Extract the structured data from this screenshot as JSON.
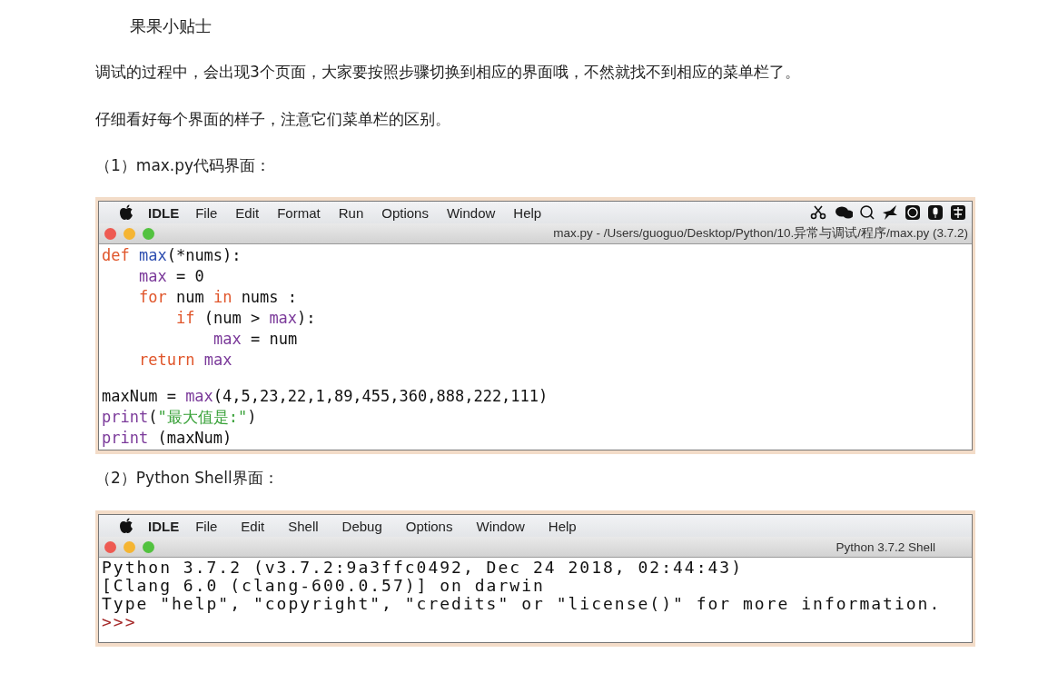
{
  "tip_title": "果果小贴士",
  "paragraphs": [
    "调试的过程中，会出现3个页面，大家要按照步骤切换到相应的界面哦，不然就找不到相应的菜单栏了。",
    "仔细看好每个界面的样子，注意它们菜单栏的区别。"
  ],
  "sections": [
    {
      "heading": "（1）max.py代码界面：",
      "window": {
        "kind": "editor",
        "app_name": "IDLE",
        "menus": [
          "File",
          "Edit",
          "Format",
          "Run",
          "Options",
          "Window",
          "Help"
        ],
        "status_icons": true,
        "title": "max.py - /Users/guoguo/Desktop/Python/10.异常与调试/程序/max.py (3.7.2)",
        "lines": [
          {
            "kind": "code",
            "segments": [
              {
                "kind": "keyword",
                "text": "def"
              },
              {
                "kind": "defname",
                "text": " max"
              },
              {
                "kind": "plain",
                "text": "(*nums):"
              }
            ],
            "children": [
              {
                "kind": "code",
                "segments": [
                  {
                    "kind": "builtin",
                    "text": "max"
                  },
                  {
                    "kind": "plain",
                    "text": " = 0"
                  }
                ]
              },
              {
                "kind": "code",
                "segments": [
                  {
                    "kind": "keyword",
                    "text": "for"
                  },
                  {
                    "kind": "plain",
                    "text": " num "
                  },
                  {
                    "kind": "keyword",
                    "text": "in"
                  },
                  {
                    "kind": "plain",
                    "text": " nums :"
                  }
                ],
                "children": [
                  {
                    "kind": "code",
                    "segments": [
                      {
                        "kind": "keyword",
                        "text": "if"
                      },
                      {
                        "kind": "plain",
                        "text": " (num > "
                      },
                      {
                        "kind": "builtin",
                        "text": "max"
                      },
                      {
                        "kind": "plain",
                        "text": "):"
                      }
                    ],
                    "children": [
                      {
                        "kind": "code",
                        "segments": [
                          {
                            "kind": "builtin",
                            "text": "max"
                          },
                          {
                            "kind": "plain",
                            "text": " = num"
                          }
                        ]
                      }
                    ]
                  }
                ]
              },
              {
                "kind": "code",
                "segments": [
                  {
                    "kind": "keyword",
                    "text": "return"
                  },
                  {
                    "kind": "builtin",
                    "text": " max"
                  }
                ]
              }
            ]
          },
          {
            "kind": "blank"
          },
          {
            "kind": "code",
            "segments": [
              {
                "kind": "plain",
                "text": "maxNum = "
              },
              {
                "kind": "builtin",
                "text": "max"
              },
              {
                "kind": "plain",
                "text": "(4,5,23,22,1,89,455,360,888,222,111)"
              }
            ]
          },
          {
            "kind": "code",
            "segments": [
              {
                "kind": "builtin",
                "text": "print"
              },
              {
                "kind": "plain",
                "text": "("
              },
              {
                "kind": "string",
                "text": "\"最大值是:\""
              },
              {
                "kind": "plain",
                "text": ")"
              }
            ]
          },
          {
            "kind": "code",
            "segments": [
              {
                "kind": "builtin",
                "text": "print"
              },
              {
                "kind": "plain",
                "text": " (maxNum)"
              }
            ]
          }
        ]
      }
    },
    {
      "heading": "（2）Python Shell界面：",
      "window": {
        "kind": "shell",
        "app_name": "IDLE",
        "menus": [
          "File",
          "Edit",
          "Shell",
          "Debug",
          "Options",
          "Window",
          "Help"
        ],
        "status_icons": false,
        "title": "Python 3.7.2 Shell",
        "lines": [
          {
            "kind": "code",
            "segments": [
              {
                "kind": "plain",
                "text": "Python 3.7.2 (v3.7.2:9a3ffc0492, Dec 24 2018, 02:44:43)"
              }
            ]
          },
          {
            "kind": "code",
            "segments": [
              {
                "kind": "plain",
                "text": "[Clang 6.0 (clang-600.0.57)] on darwin"
              }
            ]
          },
          {
            "kind": "code",
            "segments": [
              {
                "kind": "plain",
                "text": "Type \"help\", \"copyright\", \"credits\" or \"license()\" for more information."
              }
            ]
          },
          {
            "kind": "code",
            "segments": [
              {
                "kind": "prompt",
                "text": ">>>"
              }
            ]
          }
        ]
      }
    }
  ]
}
